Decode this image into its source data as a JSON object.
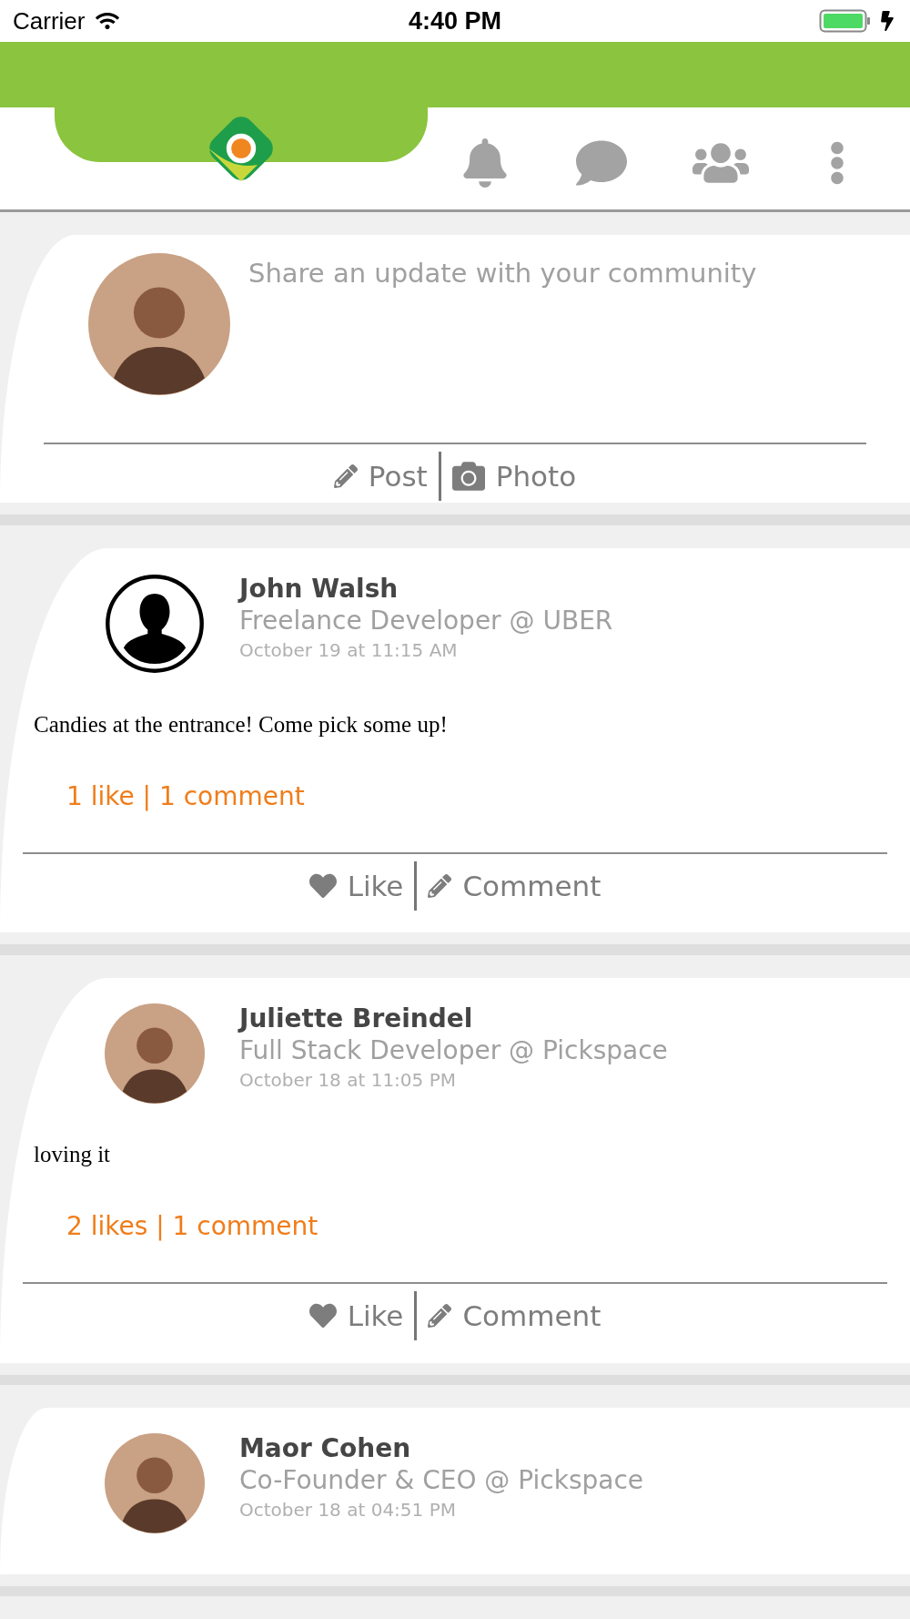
{
  "status_bar": {
    "carrier": "Carrier",
    "time": "4:40 PM"
  },
  "composer": {
    "placeholder": "Share an update with your community",
    "avatar": {
      "kind": "photo"
    },
    "actions": [
      {
        "kind": "post",
        "label": "Post"
      },
      {
        "kind": "photo",
        "label": "Photo"
      }
    ]
  },
  "posts": [
    {
      "author": "John Walsh",
      "headline": "Freelance Developer @ UBER",
      "date": "October 19 at 11:15 AM",
      "avatar": {
        "kind": "silhouette"
      },
      "text": "Candies at the entrance! Come pick some up!",
      "stats": "1 like | 1 comment",
      "actions": [
        {
          "kind": "like",
          "label": "Like"
        },
        {
          "kind": "comment",
          "label": "Comment"
        }
      ]
    },
    {
      "author": "Juliette Breindel",
      "headline": "Full Stack Developer @ Pickspace",
      "date": "October 18 at 11:05 PM",
      "avatar": {
        "kind": "photo"
      },
      "text": "loving it",
      "stats": "2 likes | 1 comment",
      "actions": [
        {
          "kind": "like",
          "label": "Like"
        },
        {
          "kind": "comment",
          "label": "Comment"
        }
      ]
    },
    {
      "author": "Maor Cohen",
      "headline": "Co-Founder & CEO @ Pickspace",
      "date": "October 18 at 04:51 PM",
      "avatar": {
        "kind": "photo"
      }
    }
  ]
}
